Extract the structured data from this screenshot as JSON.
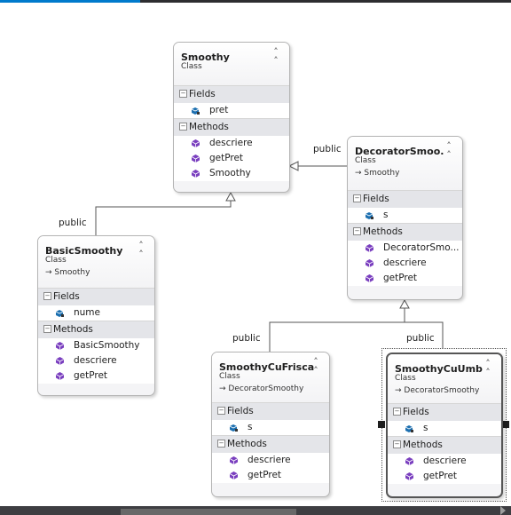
{
  "classes": {
    "smoothy": {
      "name": "Smoothy",
      "kind": "Class",
      "fields_label": "Fields",
      "fields": [
        "pret"
      ],
      "methods_label": "Methods",
      "methods": [
        "descriere",
        "getPret",
        "Smoothy"
      ]
    },
    "decorator": {
      "name": "DecoratorSmoo...",
      "kind": "Class",
      "base": "Smoothy",
      "fields_label": "Fields",
      "fields": [
        "s"
      ],
      "methods_label": "Methods",
      "methods": [
        "DecoratorSmo...",
        "descriere",
        "getPret"
      ]
    },
    "basic": {
      "name": "BasicSmoothy",
      "kind": "Class",
      "base": "Smoothy",
      "fields_label": "Fields",
      "fields": [
        "nume"
      ],
      "methods_label": "Methods",
      "methods": [
        "BasicSmoothy",
        "descriere",
        "getPret"
      ]
    },
    "frisca": {
      "name": "SmoothyCuFrisca",
      "kind": "Class",
      "base": "DecoratorSmoothy",
      "fields_label": "Fields",
      "fields": [
        "s"
      ],
      "methods_label": "Methods",
      "methods": [
        "descriere",
        "getPret"
      ]
    },
    "umbrela": {
      "name": "SmoothyCuUmb...",
      "kind": "Class",
      "base": "DecoratorSmoothy",
      "fields_label": "Fields",
      "fields": [
        "s"
      ],
      "methods_label": "Methods",
      "methods": [
        "descriere",
        "getPret"
      ]
    }
  },
  "edge_labels": {
    "decorator_to_smoothy": "public",
    "basic_to_smoothy": "public",
    "frisca_to_decorator": "public",
    "umbrela_to_decorator": "public"
  },
  "icons": {
    "collapse": "double-chevron-up-icon",
    "section_toggle": "minus-box-icon",
    "field": "field-icon",
    "method": "method-icon",
    "inherit_arrow": "arrow-icon"
  },
  "colors": {
    "accent": "#007acc",
    "field_icon": "#1c6fb0",
    "method_icon": "#7a3fbf"
  }
}
